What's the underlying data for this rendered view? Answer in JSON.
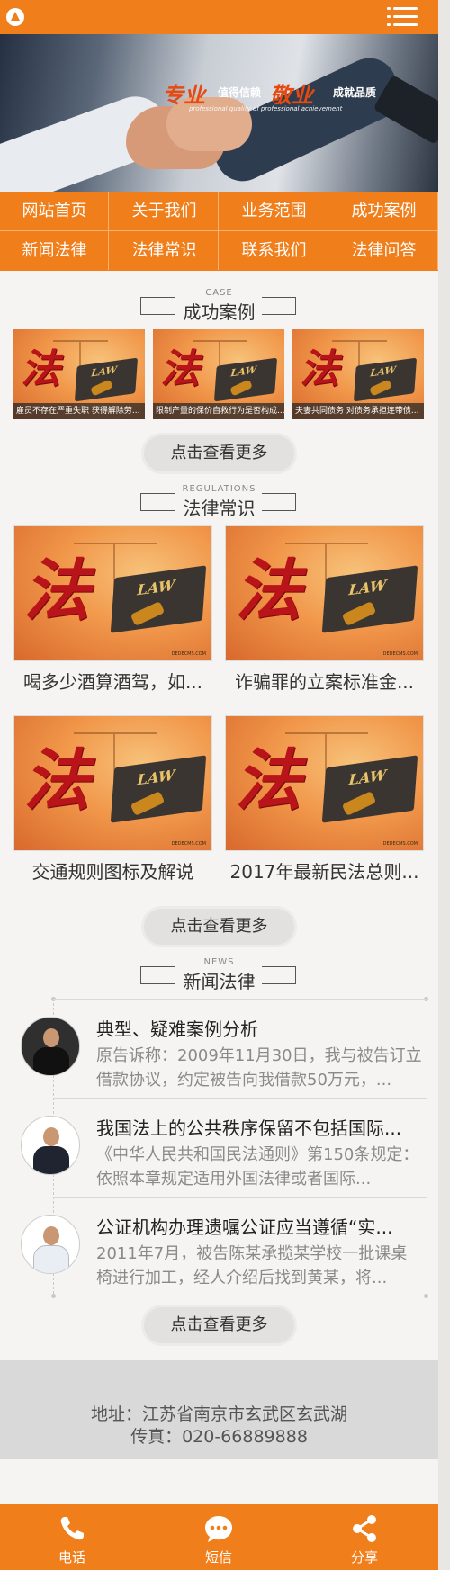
{
  "header": {
    "logo_icon": "logo-icon",
    "menu_icon": "hamburger-menu-icon",
    "brand_color": "#f07e1a"
  },
  "banner": {
    "big1": "专业",
    "small1": "值得信赖",
    "big2": "敬业",
    "small2": "成就品质",
    "sub": "professional quality of professional achievement"
  },
  "nav": {
    "items": [
      {
        "label": "网站首页"
      },
      {
        "label": "关于我们"
      },
      {
        "label": "业务范围"
      },
      {
        "label": "成功案例"
      },
      {
        "label": "新闻法律"
      },
      {
        "label": "法律常识"
      },
      {
        "label": "联系我们"
      },
      {
        "label": "法律问答"
      }
    ]
  },
  "cases": {
    "en": "CASE",
    "title": "成功案例",
    "items": [
      {
        "caption": "雇员不存在严重失职 获得解除劳..."
      },
      {
        "caption": "限制产量的保价自救行为是否构成..."
      },
      {
        "caption": "夫妻共同债务 对债务承担连带债..."
      }
    ],
    "more": "点击查看更多"
  },
  "regulations": {
    "en": "REGULATIONS",
    "title": "法律常识",
    "items": [
      {
        "title": "喝多少酒算酒驾，如..."
      },
      {
        "title": "诈骗罪的立案标准金..."
      },
      {
        "title": "交通规则图标及解说"
      },
      {
        "title": "2017年最新民法总则..."
      }
    ],
    "more": "点击查看更多"
  },
  "news": {
    "en": "NEWS",
    "title": "新闻法律",
    "items": [
      {
        "title": "典型、疑难案例分析",
        "desc": "原告诉称：2009年11月30日，我与被告订立借款协议，约定被告向我借款50万元，..."
      },
      {
        "title": "我国法上的公共秩序保留不包括国际...",
        "desc": "《中华人民共和国民法通则》第150条规定：依照本章规定适用外国法律或者国际..."
      },
      {
        "title": "公证机构办理遗嘱公证应当遵循“实...",
        "desc": "2011年7月，被告陈某承揽某学校一批课桌椅进行加工，经人介绍后找到黄某，将..."
      }
    ],
    "more": "点击查看更多"
  },
  "footer": {
    "address": "地址：江苏省南京市玄武区玄武湖",
    "fax": "传真：020-66889888"
  },
  "bottom_bar": {
    "items": [
      {
        "label": "电话",
        "icon": "phone-icon"
      },
      {
        "label": "短信",
        "icon": "message-icon"
      },
      {
        "label": "分享",
        "icon": "share-icon"
      }
    ]
  },
  "image_watermark": "DEDECMS.COM"
}
